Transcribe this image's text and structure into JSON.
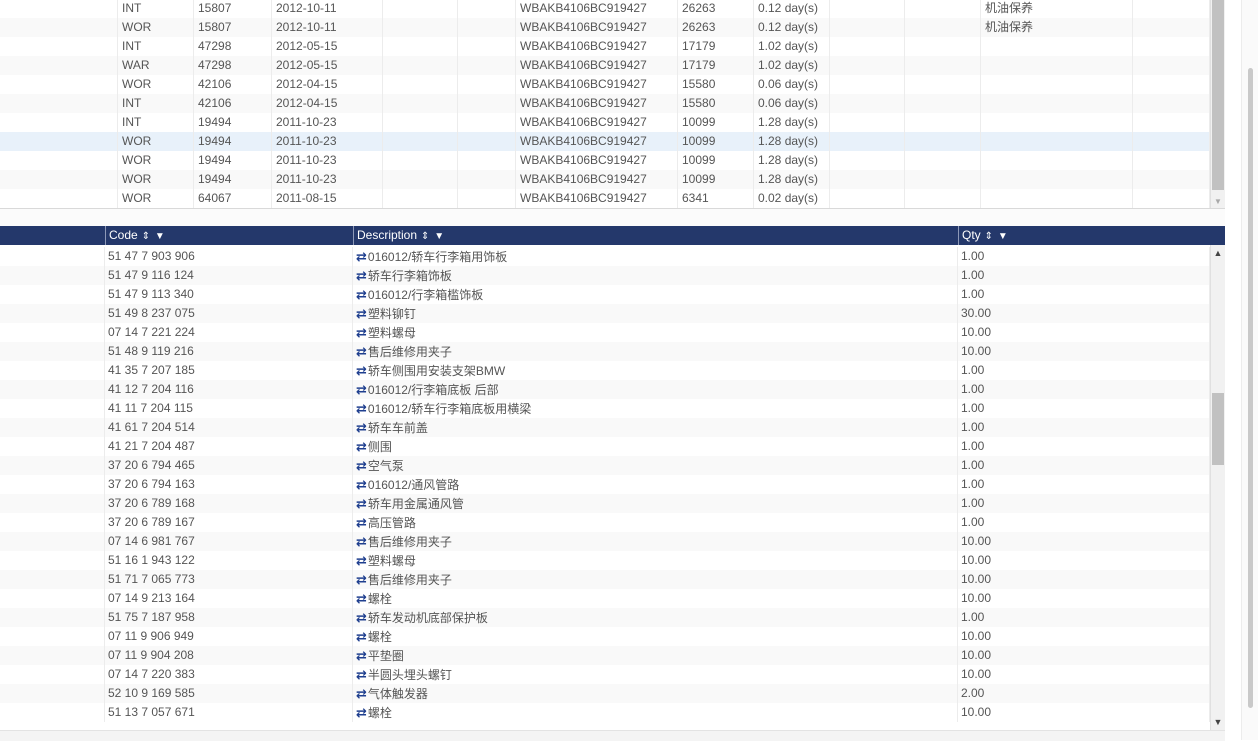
{
  "top_grid": {
    "rows": [
      {
        "type": "INT",
        "code": "15807",
        "date": "2012-10-11",
        "vin": "WBAKB4106BC919427",
        "mileage": "26263",
        "duration": "0.12 day(s)",
        "note": "机油保养"
      },
      {
        "type": "WOR",
        "code": "15807",
        "date": "2012-10-11",
        "vin": "WBAKB4106BC919427",
        "mileage": "26263",
        "duration": "0.12 day(s)",
        "note": "机油保养"
      },
      {
        "type": "INT",
        "code": "47298",
        "date": "2012-05-15",
        "vin": "WBAKB4106BC919427",
        "mileage": "17179",
        "duration": "1.02 day(s)",
        "note": ""
      },
      {
        "type": "WAR",
        "code": "47298",
        "date": "2012-05-15",
        "vin": "WBAKB4106BC919427",
        "mileage": "17179",
        "duration": "1.02 day(s)",
        "note": ""
      },
      {
        "type": "WOR",
        "code": "42106",
        "date": "2012-04-15",
        "vin": "WBAKB4106BC919427",
        "mileage": "15580",
        "duration": "0.06 day(s)",
        "note": ""
      },
      {
        "type": "INT",
        "code": "42106",
        "date": "2012-04-15",
        "vin": "WBAKB4106BC919427",
        "mileage": "15580",
        "duration": "0.06 day(s)",
        "note": ""
      },
      {
        "type": "INT",
        "code": "19494",
        "date": "2011-10-23",
        "vin": "WBAKB4106BC919427",
        "mileage": "10099",
        "duration": "1.28 day(s)",
        "note": ""
      },
      {
        "type": "WOR",
        "code": "19494",
        "date": "2011-10-23",
        "vin": "WBAKB4106BC919427",
        "mileage": "10099",
        "duration": "1.28 day(s)",
        "note": ""
      },
      {
        "type": "WOR",
        "code": "19494",
        "date": "2011-10-23",
        "vin": "WBAKB4106BC919427",
        "mileage": "10099",
        "duration": "1.28 day(s)",
        "note": ""
      },
      {
        "type": "WOR",
        "code": "19494",
        "date": "2011-10-23",
        "vin": "WBAKB4106BC919427",
        "mileage": "10099",
        "duration": "1.28 day(s)",
        "note": ""
      },
      {
        "type": "WOR",
        "code": "64067",
        "date": "2011-08-15",
        "vin": "WBAKB4106BC919427",
        "mileage": "6341",
        "duration": "0.02 day(s)",
        "note": ""
      }
    ],
    "selected_row_index": 7
  },
  "bottom_grid": {
    "headers": {
      "code": "Code",
      "description": "Description",
      "qty": "Qty"
    },
    "header_controls": "⇕ ▼",
    "link_glyph": "⇄",
    "rows": [
      {
        "code": "51 47 7 903 906",
        "description": "016012/轿车行李箱用饰板",
        "qty": "1.00"
      },
      {
        "code": "51 47 9 116 124",
        "description": "轿车行李箱饰板",
        "qty": "1.00"
      },
      {
        "code": "51 47 9 113 340",
        "description": "016012/行李箱槛饰板",
        "qty": "1.00"
      },
      {
        "code": "51 49 8 237 075",
        "description": "塑料铆钉",
        "qty": "30.00"
      },
      {
        "code": "07 14 7 221 224",
        "description": "塑料螺母",
        "qty": "10.00"
      },
      {
        "code": "51 48 9 119 216",
        "description": "售后维修用夹子",
        "qty": "10.00"
      },
      {
        "code": "41 35 7 207 185",
        "description": "轿车侧围用安装支架BMW",
        "qty": "1.00"
      },
      {
        "code": "41 12 7 204 116",
        "description": "016012/行李箱底板 后部",
        "qty": "1.00"
      },
      {
        "code": "41 11 7 204 115",
        "description": "016012/轿车行李箱底板用横梁",
        "qty": "1.00"
      },
      {
        "code": "41 61 7 204 514",
        "description": "轿车车前盖",
        "qty": "1.00"
      },
      {
        "code": "41 21 7 204 487",
        "description": "侧围",
        "qty": "1.00"
      },
      {
        "code": "37 20 6 794 465",
        "description": "空气泵",
        "qty": "1.00"
      },
      {
        "code": "37 20 6 794 163",
        "description": "016012/通风管路",
        "qty": "1.00"
      },
      {
        "code": "37 20 6 789 168",
        "description": "轿车用金属通风管",
        "qty": "1.00"
      },
      {
        "code": "37 20 6 789 167",
        "description": "高压管路",
        "qty": "1.00"
      },
      {
        "code": "07 14 6 981 767",
        "description": "售后维修用夹子",
        "qty": "10.00"
      },
      {
        "code": "51 16 1 943 122",
        "description": "塑料螺母",
        "qty": "10.00"
      },
      {
        "code": "51 71 7 065 773",
        "description": "售后维修用夹子",
        "qty": "10.00"
      },
      {
        "code": "07 14 9 213 164",
        "description": "螺栓",
        "qty": "10.00"
      },
      {
        "code": "51 75 7 187 958",
        "description": "轿车发动机底部保护板",
        "qty": "1.00"
      },
      {
        "code": "07 11 9 906 949",
        "description": "螺栓",
        "qty": "10.00"
      },
      {
        "code": "07 11 9 904 208",
        "description": "平垫圈",
        "qty": "10.00"
      },
      {
        "code": "07 14 7 220 383",
        "description": "半圆头埋头螺钉",
        "qty": "10.00"
      },
      {
        "code": "52 10 9 169 585",
        "description": "气体触发器",
        "qty": "2.00"
      },
      {
        "code": "51 13 7 057 671",
        "description": "螺栓",
        "qty": "10.00"
      }
    ]
  },
  "scrollbars": {
    "arrow_up": "▲",
    "arrow_down": "▼"
  },
  "colors": {
    "header_bg": "#24386b",
    "selected_row": "#e8f1fa",
    "link_icon": "#1f3f8f"
  }
}
